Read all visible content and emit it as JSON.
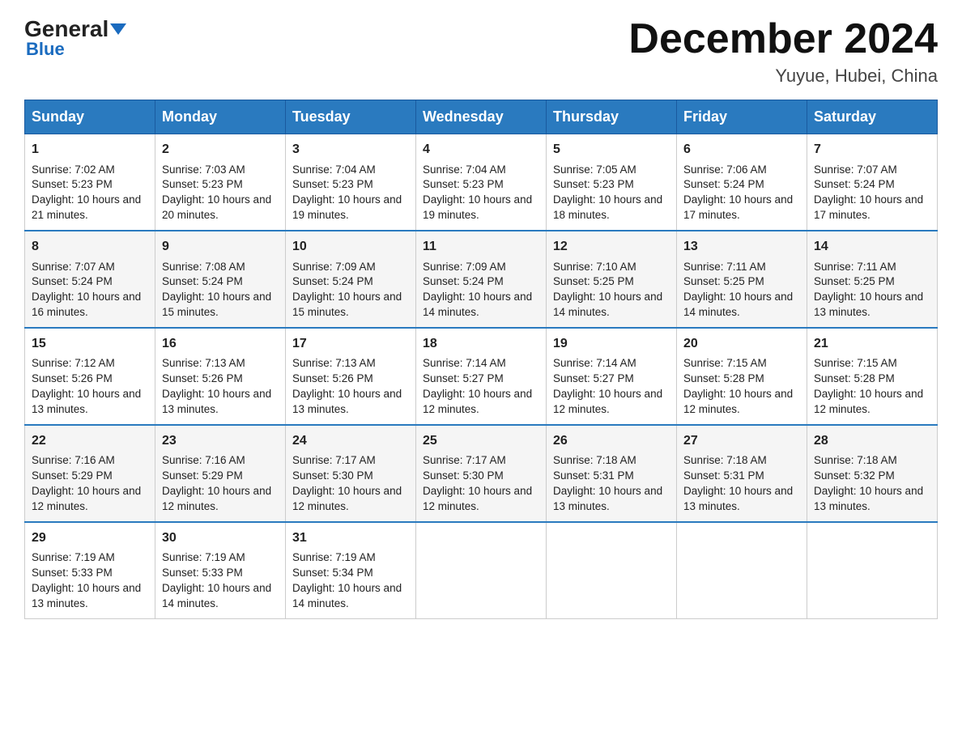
{
  "header": {
    "logo": {
      "general": "General",
      "arrow": "▶",
      "blue": "Blue"
    },
    "title": "December 2024",
    "location": "Yuyue, Hubei, China"
  },
  "calendar": {
    "columns": [
      "Sunday",
      "Monday",
      "Tuesday",
      "Wednesday",
      "Thursday",
      "Friday",
      "Saturday"
    ],
    "weeks": [
      [
        {
          "day": "1",
          "sunrise": "Sunrise: 7:02 AM",
          "sunset": "Sunset: 5:23 PM",
          "daylight": "Daylight: 10 hours and 21 minutes."
        },
        {
          "day": "2",
          "sunrise": "Sunrise: 7:03 AM",
          "sunset": "Sunset: 5:23 PM",
          "daylight": "Daylight: 10 hours and 20 minutes."
        },
        {
          "day": "3",
          "sunrise": "Sunrise: 7:04 AM",
          "sunset": "Sunset: 5:23 PM",
          "daylight": "Daylight: 10 hours and 19 minutes."
        },
        {
          "day": "4",
          "sunrise": "Sunrise: 7:04 AM",
          "sunset": "Sunset: 5:23 PM",
          "daylight": "Daylight: 10 hours and 19 minutes."
        },
        {
          "day": "5",
          "sunrise": "Sunrise: 7:05 AM",
          "sunset": "Sunset: 5:23 PM",
          "daylight": "Daylight: 10 hours and 18 minutes."
        },
        {
          "day": "6",
          "sunrise": "Sunrise: 7:06 AM",
          "sunset": "Sunset: 5:24 PM",
          "daylight": "Daylight: 10 hours and 17 minutes."
        },
        {
          "day": "7",
          "sunrise": "Sunrise: 7:07 AM",
          "sunset": "Sunset: 5:24 PM",
          "daylight": "Daylight: 10 hours and 17 minutes."
        }
      ],
      [
        {
          "day": "8",
          "sunrise": "Sunrise: 7:07 AM",
          "sunset": "Sunset: 5:24 PM",
          "daylight": "Daylight: 10 hours and 16 minutes."
        },
        {
          "day": "9",
          "sunrise": "Sunrise: 7:08 AM",
          "sunset": "Sunset: 5:24 PM",
          "daylight": "Daylight: 10 hours and 15 minutes."
        },
        {
          "day": "10",
          "sunrise": "Sunrise: 7:09 AM",
          "sunset": "Sunset: 5:24 PM",
          "daylight": "Daylight: 10 hours and 15 minutes."
        },
        {
          "day": "11",
          "sunrise": "Sunrise: 7:09 AM",
          "sunset": "Sunset: 5:24 PM",
          "daylight": "Daylight: 10 hours and 14 minutes."
        },
        {
          "day": "12",
          "sunrise": "Sunrise: 7:10 AM",
          "sunset": "Sunset: 5:25 PM",
          "daylight": "Daylight: 10 hours and 14 minutes."
        },
        {
          "day": "13",
          "sunrise": "Sunrise: 7:11 AM",
          "sunset": "Sunset: 5:25 PM",
          "daylight": "Daylight: 10 hours and 14 minutes."
        },
        {
          "day": "14",
          "sunrise": "Sunrise: 7:11 AM",
          "sunset": "Sunset: 5:25 PM",
          "daylight": "Daylight: 10 hours and 13 minutes."
        }
      ],
      [
        {
          "day": "15",
          "sunrise": "Sunrise: 7:12 AM",
          "sunset": "Sunset: 5:26 PM",
          "daylight": "Daylight: 10 hours and 13 minutes."
        },
        {
          "day": "16",
          "sunrise": "Sunrise: 7:13 AM",
          "sunset": "Sunset: 5:26 PM",
          "daylight": "Daylight: 10 hours and 13 minutes."
        },
        {
          "day": "17",
          "sunrise": "Sunrise: 7:13 AM",
          "sunset": "Sunset: 5:26 PM",
          "daylight": "Daylight: 10 hours and 13 minutes."
        },
        {
          "day": "18",
          "sunrise": "Sunrise: 7:14 AM",
          "sunset": "Sunset: 5:27 PM",
          "daylight": "Daylight: 10 hours and 12 minutes."
        },
        {
          "day": "19",
          "sunrise": "Sunrise: 7:14 AM",
          "sunset": "Sunset: 5:27 PM",
          "daylight": "Daylight: 10 hours and 12 minutes."
        },
        {
          "day": "20",
          "sunrise": "Sunrise: 7:15 AM",
          "sunset": "Sunset: 5:28 PM",
          "daylight": "Daylight: 10 hours and 12 minutes."
        },
        {
          "day": "21",
          "sunrise": "Sunrise: 7:15 AM",
          "sunset": "Sunset: 5:28 PM",
          "daylight": "Daylight: 10 hours and 12 minutes."
        }
      ],
      [
        {
          "day": "22",
          "sunrise": "Sunrise: 7:16 AM",
          "sunset": "Sunset: 5:29 PM",
          "daylight": "Daylight: 10 hours and 12 minutes."
        },
        {
          "day": "23",
          "sunrise": "Sunrise: 7:16 AM",
          "sunset": "Sunset: 5:29 PM",
          "daylight": "Daylight: 10 hours and 12 minutes."
        },
        {
          "day": "24",
          "sunrise": "Sunrise: 7:17 AM",
          "sunset": "Sunset: 5:30 PM",
          "daylight": "Daylight: 10 hours and 12 minutes."
        },
        {
          "day": "25",
          "sunrise": "Sunrise: 7:17 AM",
          "sunset": "Sunset: 5:30 PM",
          "daylight": "Daylight: 10 hours and 12 minutes."
        },
        {
          "day": "26",
          "sunrise": "Sunrise: 7:18 AM",
          "sunset": "Sunset: 5:31 PM",
          "daylight": "Daylight: 10 hours and 13 minutes."
        },
        {
          "day": "27",
          "sunrise": "Sunrise: 7:18 AM",
          "sunset": "Sunset: 5:31 PM",
          "daylight": "Daylight: 10 hours and 13 minutes."
        },
        {
          "day": "28",
          "sunrise": "Sunrise: 7:18 AM",
          "sunset": "Sunset: 5:32 PM",
          "daylight": "Daylight: 10 hours and 13 minutes."
        }
      ],
      [
        {
          "day": "29",
          "sunrise": "Sunrise: 7:19 AM",
          "sunset": "Sunset: 5:33 PM",
          "daylight": "Daylight: 10 hours and 13 minutes."
        },
        {
          "day": "30",
          "sunrise": "Sunrise: 7:19 AM",
          "sunset": "Sunset: 5:33 PM",
          "daylight": "Daylight: 10 hours and 14 minutes."
        },
        {
          "day": "31",
          "sunrise": "Sunrise: 7:19 AM",
          "sunset": "Sunset: 5:34 PM",
          "daylight": "Daylight: 10 hours and 14 minutes."
        },
        null,
        null,
        null,
        null
      ]
    ]
  }
}
